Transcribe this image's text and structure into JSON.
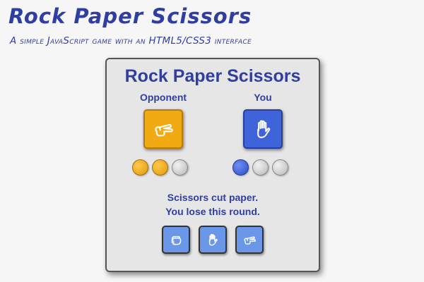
{
  "header": {
    "title": "Rock Paper Scissors",
    "subtitle": "A simple JavaScript game with an HTML5/CSS3 interface"
  },
  "game": {
    "title": "Rock Paper Scissors",
    "opponent_label": "Opponent",
    "you_label": "You",
    "opponent_choice_icon": "scissors-hand-icon",
    "player_choice_icon": "paper-hand-icon",
    "opponent_score": {
      "won": 2,
      "total": 3
    },
    "player_score": {
      "won": 1,
      "total": 3
    },
    "message_line1": "Scissors cut paper.",
    "message_line2": "You lose this round.",
    "choices": [
      {
        "icon": "rock-hand-icon"
      },
      {
        "icon": "paper-hand-icon"
      },
      {
        "icon": "scissors-hand-icon"
      }
    ]
  },
  "colors": {
    "title": "#2f3ea0",
    "opponent": "#f2aa12",
    "player": "#3f63d8",
    "choice_button": "#6a97e8",
    "panel": "#e6e6e6",
    "background": "#f6f6f6"
  }
}
